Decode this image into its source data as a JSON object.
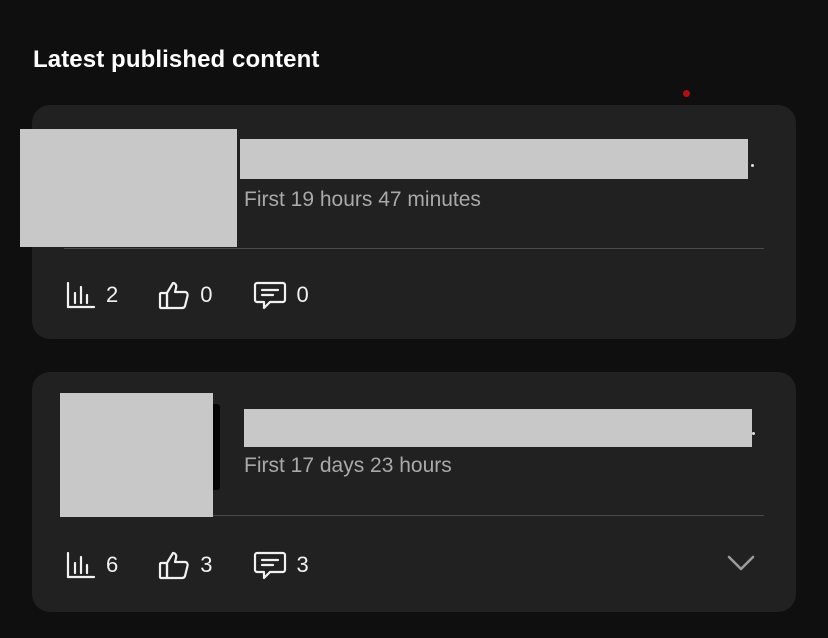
{
  "section": {
    "title": "Latest published content"
  },
  "cards": [
    {
      "meta": "First 19 hours 47 minutes",
      "views": "2",
      "likes": "0",
      "comments": "0"
    },
    {
      "meta": "First 17 days 23 hours",
      "views": "6",
      "likes": "3",
      "comments": "3"
    }
  ],
  "icons": {
    "views": "bar-chart-icon",
    "likes": "thumbs-up-icon",
    "comments": "comment-icon",
    "expand": "chevron-down-icon"
  },
  "colors": {
    "background": "#0f0f0f",
    "card": "#212121",
    "notification_dot": "#b30e0e"
  }
}
